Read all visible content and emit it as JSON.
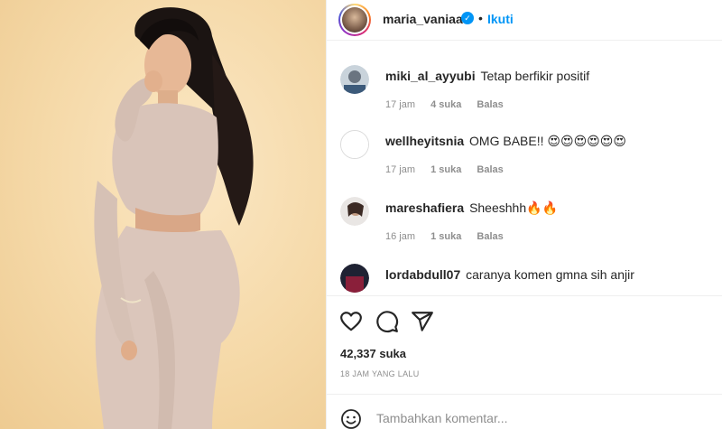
{
  "photo": {
    "alt": "post-photo"
  },
  "header": {
    "username": "maria_vaniaa",
    "verified_badge": "verified-icon",
    "separator": "•",
    "follow_label": "Ikuti"
  },
  "comments": [
    {
      "username": "miki_al_ayyubi",
      "text": "Tetap berfikir positif",
      "time": "17 jam",
      "likes": "4 suka",
      "reply": "Balas"
    },
    {
      "username": "wellheyitsnia",
      "text": "OMG BABE!! 😍😍😍😍😍😍",
      "time": "17 jam",
      "likes": "1 suka",
      "reply": "Balas"
    },
    {
      "username": "mareshafiera",
      "text": "Sheeshhh🔥🔥",
      "time": "16 jam",
      "likes": "1 suka",
      "reply": "Balas"
    },
    {
      "username": "lordabdull07",
      "text": "caranya komen gmna sih anjir",
      "time": "",
      "likes": "",
      "reply": ""
    }
  ],
  "actions": {
    "like_icon": "heart-icon",
    "comment_icon": "comment-icon",
    "share_icon": "share-icon",
    "likes_count": "42,337 suka",
    "timestamp": "18 JAM YANG LALU"
  },
  "add_comment": {
    "emoji_icon": "emoji-icon",
    "placeholder": "Tambahkan komentar..."
  },
  "colors": {
    "link_blue": "#0095f6",
    "text": "#262626",
    "muted": "#8e8e8e",
    "divider": "#efefef",
    "photo_bg": "#f5d9a8"
  }
}
